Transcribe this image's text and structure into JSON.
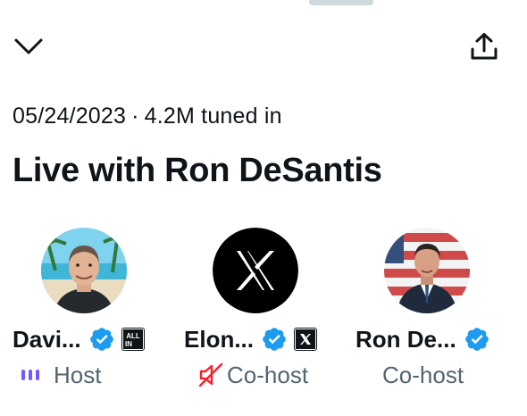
{
  "header": {
    "collapse_icon": "chevron-down-icon",
    "share_icon": "share-upload-icon"
  },
  "meta": {
    "date": "05/24/2023",
    "separator": "·",
    "tuned_in": "4.2M tuned in"
  },
  "title": "Live with Ron DeSantis",
  "participants": [
    {
      "name": "Davi...",
      "role": "Host",
      "verified": true,
      "affiliation_icon": "all-in-badge-icon",
      "affiliation_text": "ALL IN",
      "status_icon": "speaking-bars-icon"
    },
    {
      "name": "Elon...",
      "role": "Co-host",
      "verified": true,
      "affiliation_icon": "x-badge-icon",
      "status_icon": "mic-muted-icon"
    },
    {
      "name": "Ron De...",
      "role": "Co-host",
      "verified": true
    }
  ],
  "colors": {
    "verified_blue": "#1d9bf0",
    "speaking_purple": "#7856ff",
    "muted_red": "#f4212e",
    "secondary_text": "#536471"
  }
}
